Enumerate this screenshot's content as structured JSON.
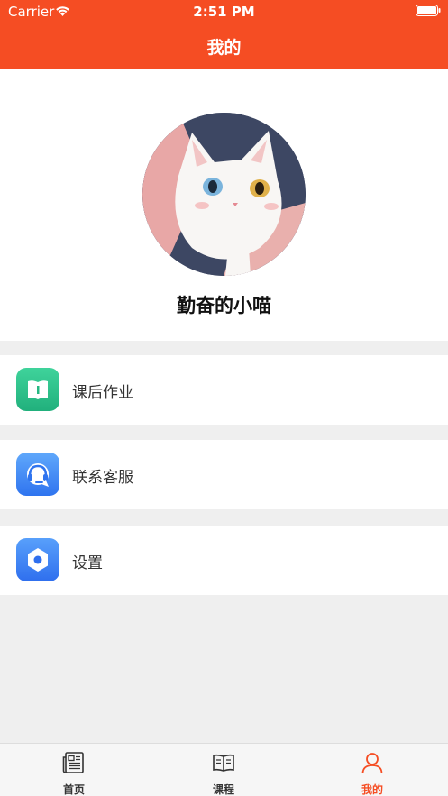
{
  "status_bar": {
    "carrier": "Carrier",
    "time": "2:51 PM"
  },
  "header": {
    "title": "我的"
  },
  "profile": {
    "username": "勤奋的小喵"
  },
  "menu": [
    {
      "label": "课后作业",
      "icon": "book-icon",
      "color": "#2fc28c"
    },
    {
      "label": "联系客服",
      "icon": "headset-icon",
      "color": "#3b82f6"
    },
    {
      "label": "设置",
      "icon": "hexagon-settings-icon",
      "color": "#3b7cf5"
    }
  ],
  "tabs": [
    {
      "label": "首页",
      "icon": "newspaper-icon",
      "active": false
    },
    {
      "label": "课程",
      "icon": "open-book-icon",
      "active": false
    },
    {
      "label": "我的",
      "icon": "person-icon",
      "active": true
    }
  ],
  "colors": {
    "accent": "#f54d23",
    "background": "#efefef"
  }
}
